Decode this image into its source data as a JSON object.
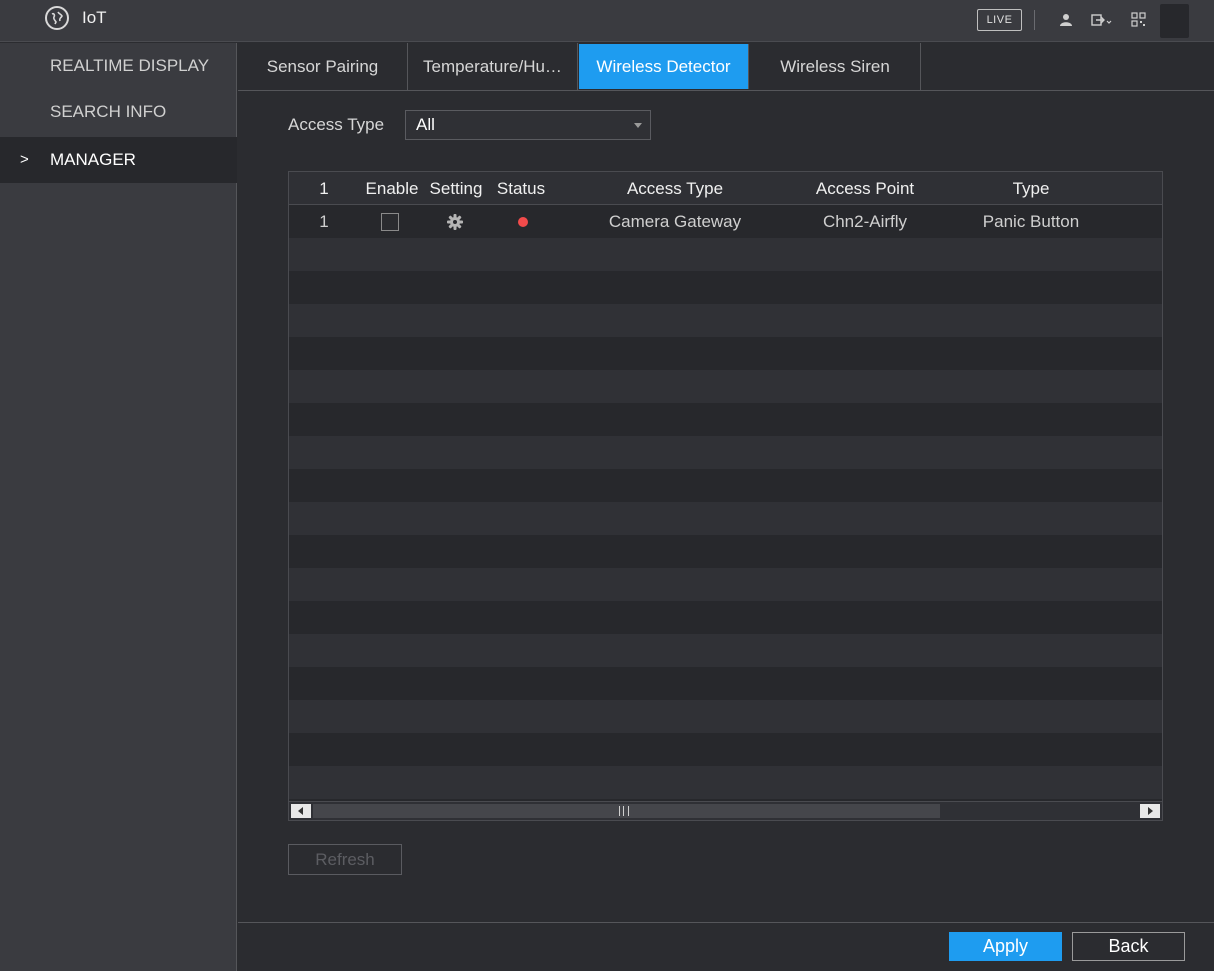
{
  "window": {
    "title": "IoT",
    "live_label": "LIVE"
  },
  "sidebar": {
    "items": [
      {
        "label": "REALTIME DISPLAY",
        "active": false
      },
      {
        "label": "SEARCH INFO",
        "active": false
      },
      {
        "label": "MANAGER",
        "active": true
      }
    ],
    "active_marker": ">"
  },
  "tabs": [
    {
      "label": "Sensor Pairing",
      "active": false
    },
    {
      "label": "Temperature/Hu…",
      "active": false
    },
    {
      "label": "Wireless Detector",
      "active": true
    },
    {
      "label": "Wireless Siren",
      "active": false
    }
  ],
  "filter": {
    "label": "Access Type",
    "selected": "All"
  },
  "table": {
    "headers": [
      "1",
      "Enable",
      "Setting",
      "Status",
      "Access Type",
      "Access Point",
      "Type"
    ],
    "rows": [
      {
        "index": "1",
        "enabled": false,
        "status_color": "#f24b4b",
        "access_type": "Camera Gateway",
        "access_point": "Chn2-Airfly",
        "type": "Panic Button"
      }
    ]
  },
  "buttons": {
    "refresh": "Refresh",
    "apply": "Apply",
    "back": "Back"
  },
  "colors": {
    "accent": "#1e9cf0",
    "status_offline": "#f24b4b",
    "background": "#2b2c30"
  }
}
